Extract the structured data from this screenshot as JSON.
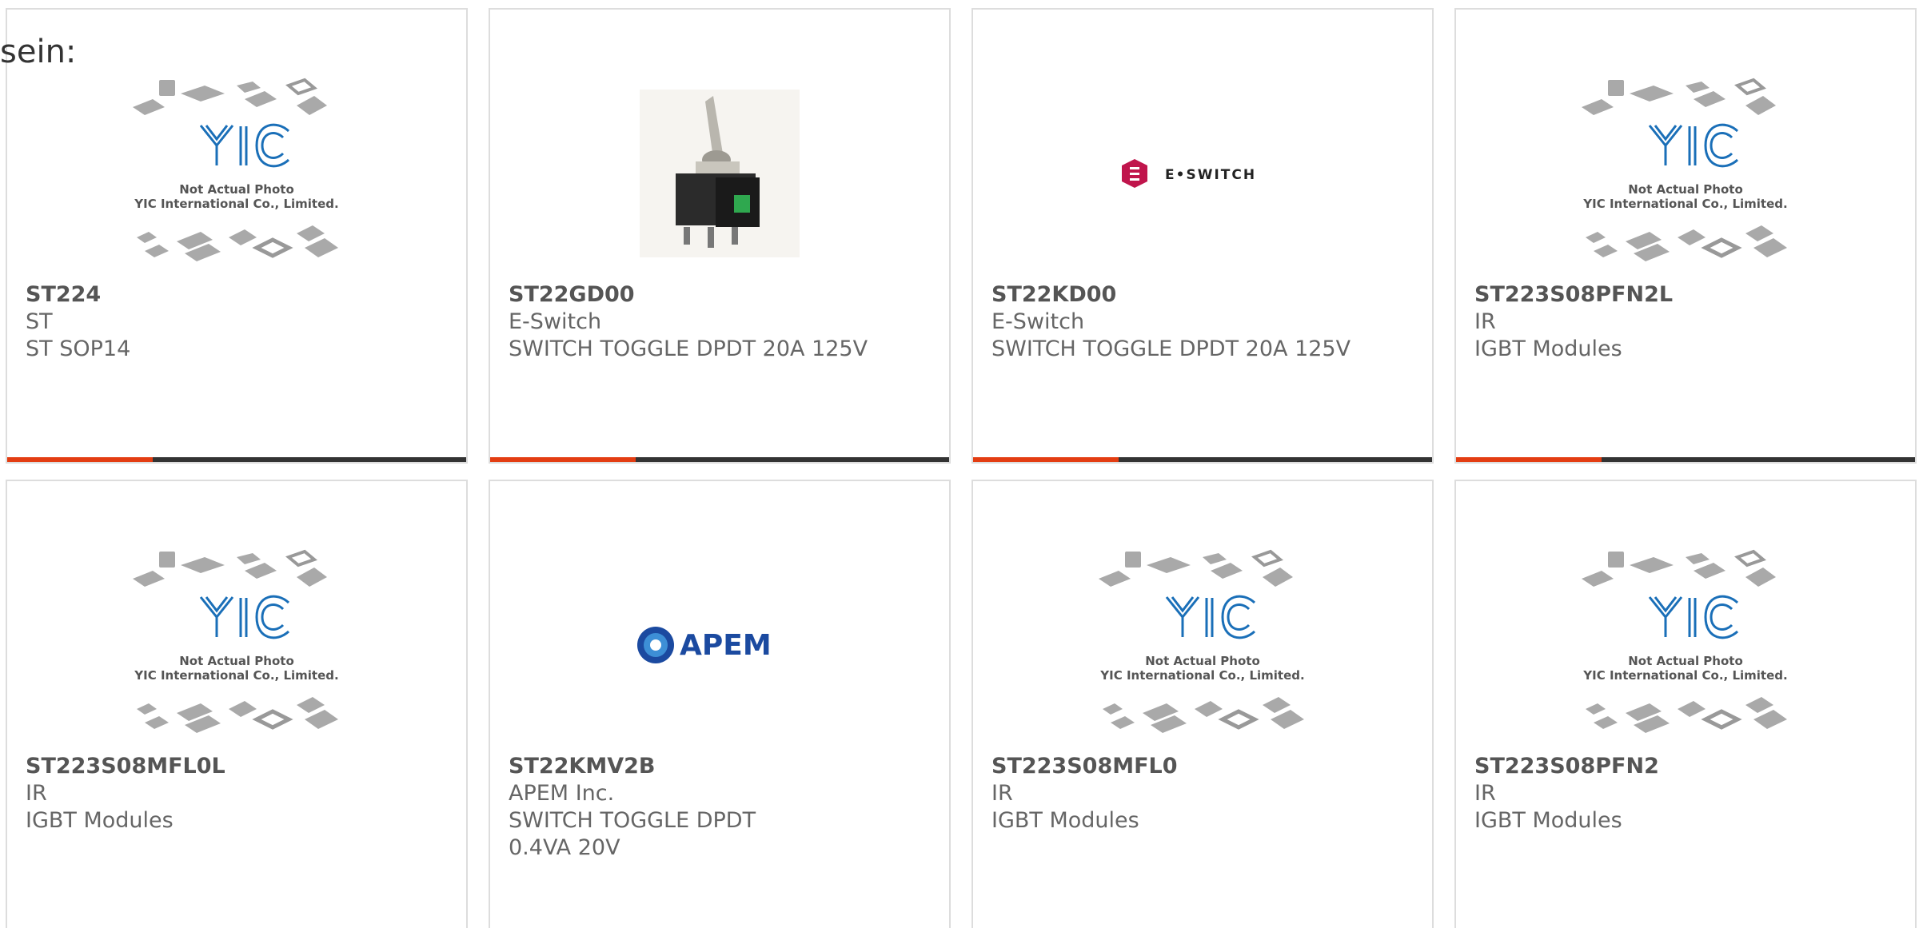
{
  "intro": "sein:",
  "placeholder": {
    "line1": "Not Actual Photo",
    "line2": "YIC International Co., Limited."
  },
  "logos": {
    "eswitch": "E•SWITCH",
    "apem": "APEM"
  },
  "products": [
    {
      "pn": "ST224",
      "mfr": "ST",
      "desc": "ST SOP14",
      "image": "yic-placeholder"
    },
    {
      "pn": "ST22GD00",
      "mfr": "E-Switch",
      "desc": "SWITCH TOGGLE DPDT 20A 125V",
      "image": "toggle-switch-photo"
    },
    {
      "pn": "ST22KD00",
      "mfr": "E-Switch",
      "desc": "SWITCH TOGGLE DPDT 20A 125V",
      "image": "eswitch-logo"
    },
    {
      "pn": "ST223S08PFN2L",
      "mfr": "IR",
      "desc": "IGBT Modules",
      "image": "yic-placeholder"
    },
    {
      "pn": "ST223S08MFL0L",
      "mfr": "IR",
      "desc": "IGBT Modules",
      "image": "yic-placeholder"
    },
    {
      "pn": "ST22KMV2B",
      "mfr": "APEM Inc.",
      "desc": "SWITCH TOGGLE DPDT 0.4VA 20V",
      "image": "apem-logo"
    },
    {
      "pn": "ST223S08MFL0",
      "mfr": "IR",
      "desc": "IGBT Modules",
      "image": "yic-placeholder"
    },
    {
      "pn": "ST223S08PFN2",
      "mfr": "IR",
      "desc": "IGBT Modules",
      "image": "yic-placeholder"
    }
  ],
  "colors": {
    "accent": "#e33d12",
    "bar": "#333333",
    "yic_blue": "#1a6fb8",
    "eswitch": "#c0154c",
    "apem": "#1b4aa0"
  }
}
